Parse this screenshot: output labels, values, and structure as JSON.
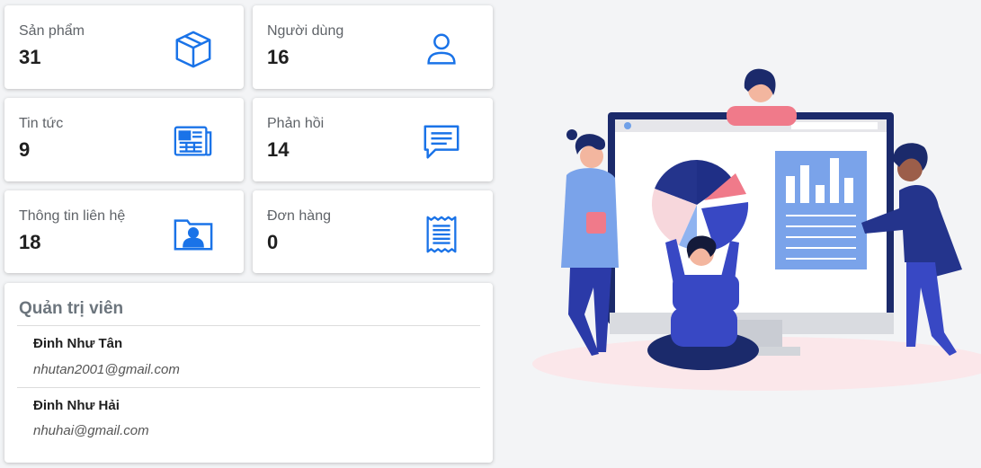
{
  "stats": [
    {
      "label": "Sản phẩm",
      "value": "31",
      "icon": "box-icon"
    },
    {
      "label": "Người dùng",
      "value": "16",
      "icon": "user-icon"
    },
    {
      "label": "Tin tức",
      "value": "9",
      "icon": "newspaper-icon"
    },
    {
      "label": "Phản hồi",
      "value": "14",
      "icon": "chat-icon"
    },
    {
      "label": "Thông tin liên hệ",
      "value": "18",
      "icon": "contact-card-icon"
    },
    {
      "label": "Đơn hàng",
      "value": "0",
      "icon": "receipt-icon"
    }
  ],
  "admins": {
    "title": "Quản trị viên",
    "list": [
      {
        "name": "Đinh Như Tân",
        "email": "nhutan2001@gmail.com"
      },
      {
        "name": "Đinh Như Hải",
        "email": "nhuhai@gmail.com"
      }
    ]
  },
  "colors": {
    "accent": "#1a73e8",
    "illustration_navy": "#2b3a8f",
    "illustration_pink": "#f07a8a"
  }
}
